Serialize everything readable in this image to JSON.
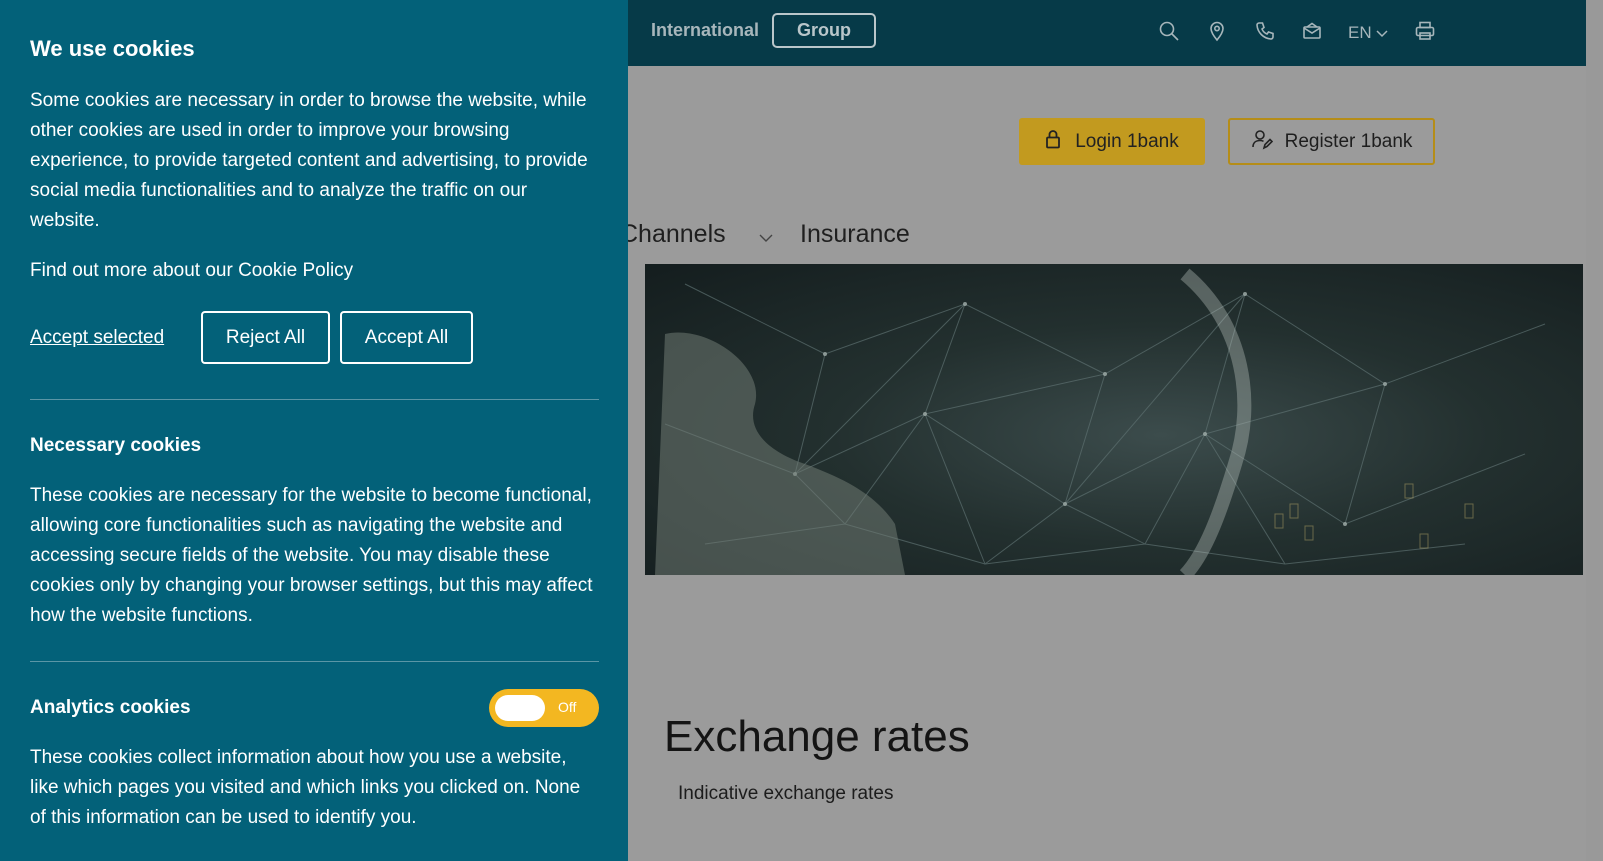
{
  "site": {
    "topbar": {
      "international": "International",
      "group": "Group",
      "language": "EN",
      "icons": [
        "search-icon",
        "location-pin-icon",
        "phone-icon",
        "mail-icon",
        "chevron-down-icon",
        "printer-icon"
      ]
    },
    "buttons": {
      "login": "Login 1bank",
      "register": "Register 1bank"
    },
    "nav": {
      "channels": "Channels",
      "insurance": "Insurance"
    },
    "page_title": "Exchange rates",
    "page_subtitle": "Indicative exchange rates",
    "colors": {
      "topbar": "#063a48",
      "gold": "#c29a1f"
    }
  },
  "cookie": {
    "title": "We use cookies",
    "intro": "Some cookies are necessary in order to browse the website, while other cookies are used in order to improve your browsing experience, to provide targeted content and advertising, to provide social media functionalities and to analyze the traffic on our website.",
    "policy_link": "Find out more about our Cookie Policy",
    "accept_selected": "Accept selected",
    "reject_all": "Reject All",
    "accept_all": "Accept All",
    "necessary_title": "Necessary cookies",
    "necessary_text": "These cookies are necessary for the website to become functional, allowing core functionalities such as navigating the website and accessing secure fields of the website. You may disable these cookies only by changing your browser settings, but this may affect how the website functions.",
    "analytics_title": "Analytics cookies",
    "analytics_toggle": "Off",
    "analytics_text": "These cookies collect information about how you use a website, like which pages you visited and which links you clicked on. None of this information can be used to identify you.",
    "colors": {
      "panel": "#036179",
      "toggle": "#f3b721"
    }
  }
}
